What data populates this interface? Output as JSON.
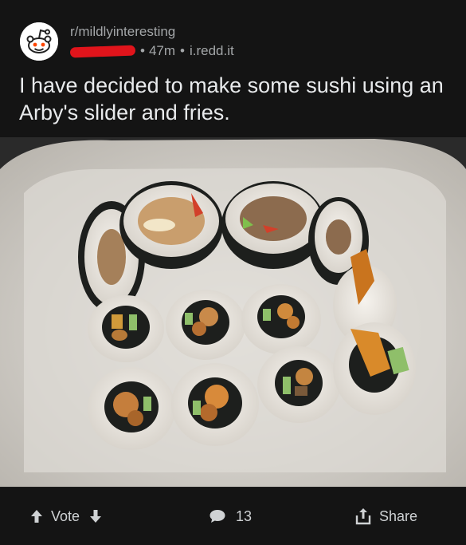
{
  "post": {
    "subreddit": "r/mildlyinteresting",
    "age": "47m",
    "domain": "i.redd.it",
    "separator": "•",
    "title": "I have decided to make some sushi using an Arby's slider and fries."
  },
  "footer": {
    "vote_label": "Vote",
    "comment_count": "13",
    "share_label": "Share"
  },
  "colors": {
    "background": "#141414",
    "text": "#d7dadc",
    "muted": "#a3a6a8",
    "redaction": "#e0141b"
  },
  "icons": [
    "reddit-snoo-icon",
    "upvote-arrow-icon",
    "downvote-arrow-icon",
    "comment-bubble-icon",
    "share-icon"
  ]
}
